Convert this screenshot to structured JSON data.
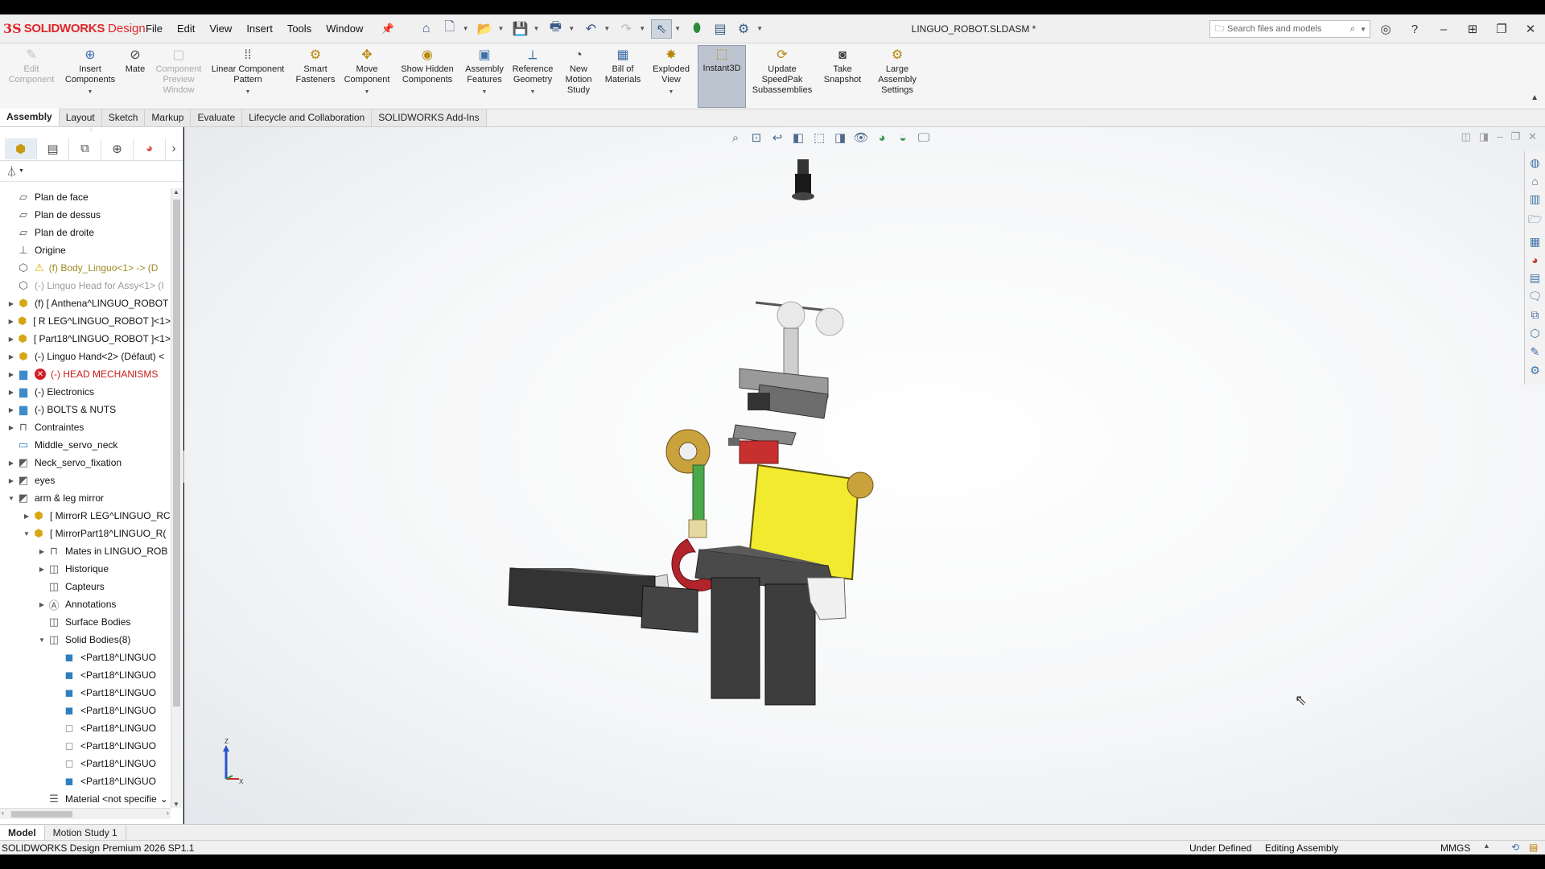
{
  "app": {
    "logo_ds": "3S",
    "logo_name": "SOLIDWORKS",
    "logo_suffix": "Design",
    "document_title": "LINGUO_ROBOT.SLDASM *"
  },
  "menu": [
    "File",
    "Edit",
    "View",
    "Insert",
    "Tools",
    "Window"
  ],
  "search": {
    "placeholder": "Search files and models"
  },
  "commands": [
    {
      "label": "Edit Component",
      "icon": "edit-component-icon",
      "enabled": false
    },
    {
      "label": "Insert Components",
      "icon": "insert-components-icon",
      "enabled": true
    },
    {
      "label": "Mate",
      "icon": "mate-icon",
      "enabled": true
    },
    {
      "label": "Component Preview Window",
      "icon": "component-preview-icon",
      "enabled": false
    },
    {
      "label": "Linear Component Pattern",
      "icon": "linear-pattern-icon",
      "enabled": true
    },
    {
      "label": "Smart Fasteners",
      "icon": "smart-fasteners-icon",
      "enabled": true
    },
    {
      "label": "Move Component",
      "icon": "move-component-icon",
      "enabled": true
    },
    {
      "label": "Show Hidden Components",
      "icon": "show-hidden-icon",
      "enabled": true
    },
    {
      "label": "Assembly Features",
      "icon": "assembly-features-icon",
      "enabled": true
    },
    {
      "label": "Reference Geometry",
      "icon": "reference-geometry-icon",
      "enabled": true
    },
    {
      "label": "New Motion Study",
      "icon": "motion-study-icon",
      "enabled": true
    },
    {
      "label": "Bill of Materials",
      "icon": "bom-icon",
      "enabled": true
    },
    {
      "label": "Exploded View",
      "icon": "exploded-view-icon",
      "enabled": true
    },
    {
      "label": "Instant3D",
      "icon": "instant3d-icon",
      "enabled": true,
      "active": true
    },
    {
      "label": "Update SpeedPak Subassemblies",
      "icon": "speedpak-icon",
      "enabled": true
    },
    {
      "label": "Take Snapshot",
      "icon": "snapshot-icon",
      "enabled": true
    },
    {
      "label": "Large Assembly Settings",
      "icon": "large-assembly-icon",
      "enabled": true
    }
  ],
  "tabs": [
    "Assembly",
    "Layout",
    "Sketch",
    "Markup",
    "Evaluate",
    "Lifecycle and Collaboration",
    "SOLIDWORKS Add-Ins"
  ],
  "active_tab": "Assembly",
  "tree": [
    {
      "label": "Plan de face",
      "indent": 0,
      "expand": "",
      "kind": "plane",
      "style": ""
    },
    {
      "label": "Plan de dessus",
      "indent": 0,
      "expand": "",
      "kind": "plane",
      "style": ""
    },
    {
      "label": "Plan de droite",
      "indent": 0,
      "expand": "",
      "kind": "plane",
      "style": ""
    },
    {
      "label": "Origine",
      "indent": 0,
      "expand": "",
      "kind": "origin",
      "style": ""
    },
    {
      "label": "(f) Body_Linguo<1> -> (D",
      "indent": 0,
      "expand": "",
      "kind": "part",
      "style": "yellow",
      "badge": "warn"
    },
    {
      "label": "(-) Linguo Head for Assy<1> (I",
      "indent": 0,
      "expand": "",
      "kind": "part",
      "style": "gray"
    },
    {
      "label": "(f) [ Anthena^LINGUO_ROBOT",
      "indent": 0,
      "expand": "right",
      "kind": "asm",
      "style": ""
    },
    {
      "label": "[ R LEG^LINGUO_ROBOT ]<1>",
      "indent": 0,
      "expand": "right",
      "kind": "asm",
      "style": ""
    },
    {
      "label": "[ Part18^LINGUO_ROBOT ]<1>",
      "indent": 0,
      "expand": "right",
      "kind": "asm",
      "style": ""
    },
    {
      "label": "(-) Linguo Hand<2> (Défaut) <",
      "indent": 0,
      "expand": "right",
      "kind": "asm",
      "style": ""
    },
    {
      "label": "(-) HEAD MECHANISMS",
      "indent": 0,
      "expand": "right",
      "kind": "folder",
      "style": "red",
      "badge": "err"
    },
    {
      "label": "(-) Electronics",
      "indent": 0,
      "expand": "right",
      "kind": "folder",
      "style": ""
    },
    {
      "label": "(-) BOLTS & NUTS",
      "indent": 0,
      "expand": "right",
      "kind": "folder",
      "style": ""
    },
    {
      "label": "Contraintes",
      "indent": 0,
      "expand": "right",
      "kind": "mates",
      "style": ""
    },
    {
      "label": "Middle_servo_neck",
      "indent": 0,
      "expand": "",
      "kind": "sketch",
      "style": ""
    },
    {
      "label": "Neck_servo_fixation",
      "indent": 0,
      "expand": "right",
      "kind": "feature",
      "style": ""
    },
    {
      "label": "eyes",
      "indent": 0,
      "expand": "right",
      "kind": "feature",
      "style": ""
    },
    {
      "label": "arm & leg mirror",
      "indent": 0,
      "expand": "down",
      "kind": "feature",
      "style": ""
    },
    {
      "label": "[ MirrorR LEG^LINGUO_RC",
      "indent": 1,
      "expand": "right",
      "kind": "asm",
      "style": ""
    },
    {
      "label": "[ MirrorPart18^LINGUO_R(",
      "indent": 1,
      "expand": "down",
      "kind": "asm",
      "style": ""
    },
    {
      "label": "Mates in LINGUO_ROB",
      "indent": 2,
      "expand": "right",
      "kind": "mates",
      "style": ""
    },
    {
      "label": "Historique",
      "indent": 2,
      "expand": "right",
      "kind": "history",
      "style": ""
    },
    {
      "label": "Capteurs",
      "indent": 2,
      "expand": "",
      "kind": "sensor",
      "style": ""
    },
    {
      "label": "Annotations",
      "indent": 2,
      "expand": "right",
      "kind": "annot",
      "style": ""
    },
    {
      "label": "Surface Bodies",
      "indent": 2,
      "expand": "",
      "kind": "surf",
      "style": ""
    },
    {
      "label": "Solid Bodies(8)",
      "indent": 2,
      "expand": "down",
      "kind": "solid",
      "style": ""
    },
    {
      "label": "<Part18^LINGUO",
      "indent": 3,
      "expand": "",
      "kind": "body",
      "style": ""
    },
    {
      "label": "<Part18^LINGUO",
      "indent": 3,
      "expand": "",
      "kind": "body",
      "style": ""
    },
    {
      "label": "<Part18^LINGUO",
      "indent": 3,
      "expand": "",
      "kind": "body",
      "style": ""
    },
    {
      "label": "<Part18^LINGUO",
      "indent": 3,
      "expand": "",
      "kind": "body",
      "style": ""
    },
    {
      "label": "<Part18^LINGUO",
      "indent": 3,
      "expand": "",
      "kind": "bodyo",
      "style": ""
    },
    {
      "label": "<Part18^LINGUO",
      "indent": 3,
      "expand": "",
      "kind": "bodyo",
      "style": ""
    },
    {
      "label": "<Part18^LINGUO",
      "indent": 3,
      "expand": "",
      "kind": "bodyo",
      "style": ""
    },
    {
      "label": "<Part18^LINGUO",
      "indent": 3,
      "expand": "",
      "kind": "body",
      "style": ""
    },
    {
      "label": "Material <not specifie",
      "indent": 2,
      "expand": "down-small",
      "kind": "material",
      "style": ""
    }
  ],
  "bottom_tabs": [
    "Model",
    "Motion Study 1"
  ],
  "status": {
    "product": "SOLIDWORKS Design Premium 2026 SP1.1",
    "definition": "Under Defined",
    "mode": "Editing Assembly",
    "units": "MMGS"
  },
  "triad": {
    "z_label": "Z",
    "x_label": "X"
  }
}
